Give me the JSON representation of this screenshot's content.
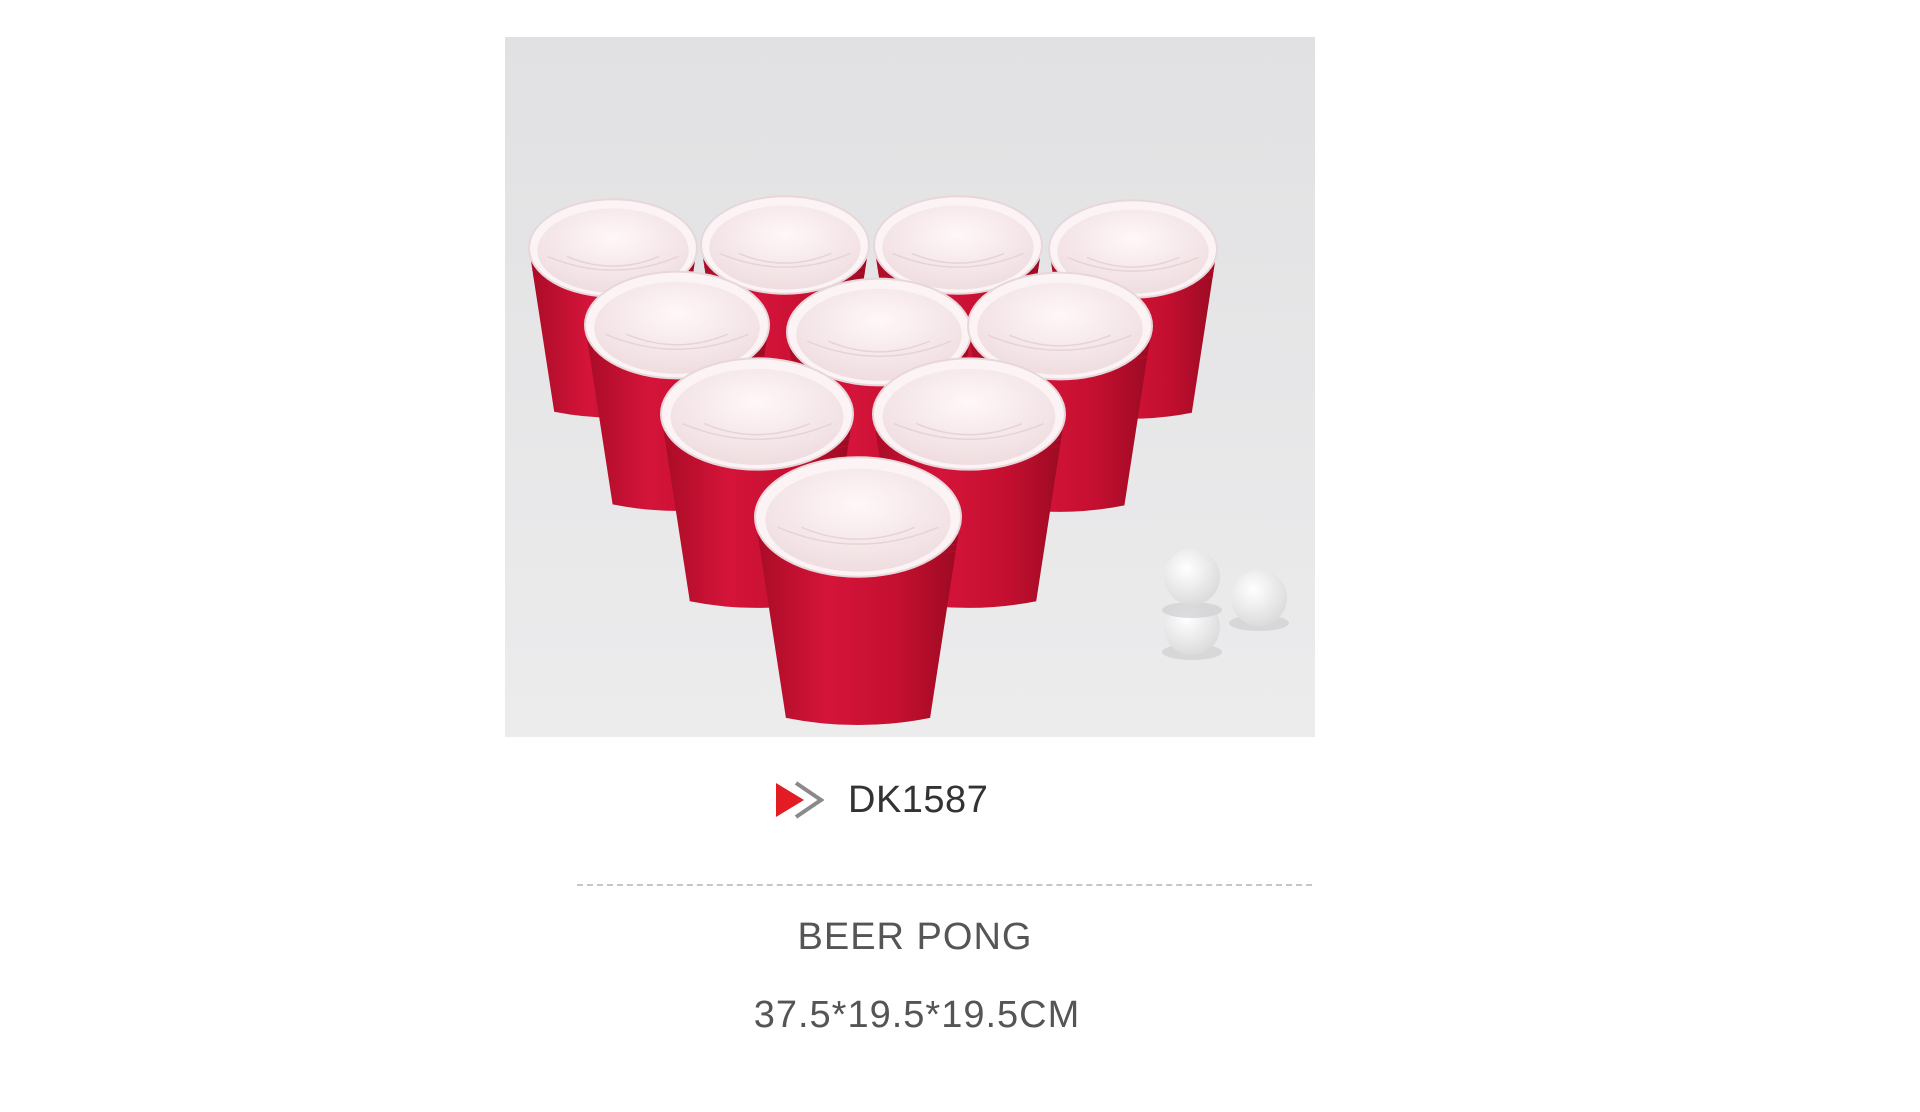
{
  "product": {
    "image": {
      "subject": "red-cups-and-white-balls",
      "background_color": "#e5e5e7",
      "cup_color": "#c8102e",
      "ball_color": "#f7f7f7"
    },
    "model": {
      "icon": "double-arrow-icon",
      "icon_colors": [
        "#e31b23",
        "#8a8a8a"
      ],
      "code": "DK1587"
    },
    "name": "BEER PONG",
    "size": "37.5*19.5*19.5CM"
  }
}
